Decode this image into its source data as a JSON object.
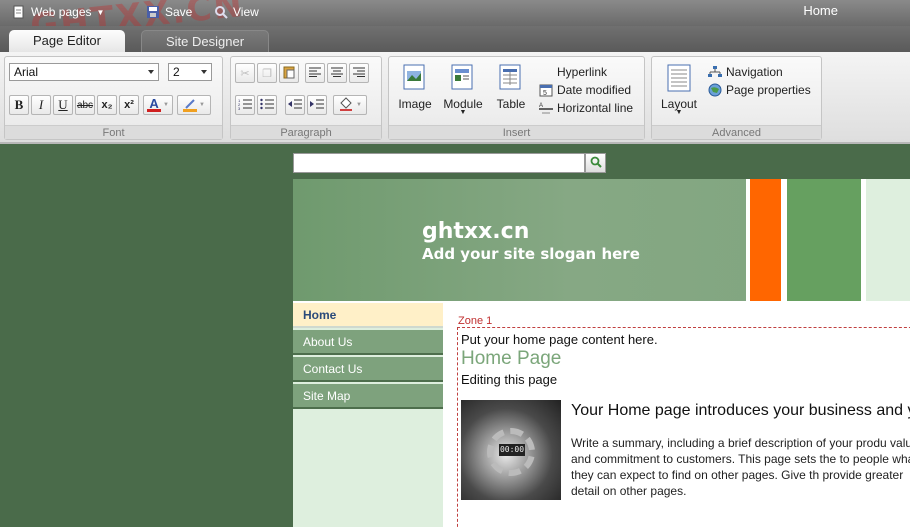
{
  "menubar": {
    "web_pages": "Web pages",
    "save": "Save",
    "view": "View",
    "home": "Home",
    "watermark": "GHTXX.CN"
  },
  "tabs": {
    "page_editor": "Page Editor",
    "site_designer": "Site Designer"
  },
  "ribbon": {
    "font": {
      "label": "Font",
      "family": "Arial",
      "size": "2",
      "bold": "B",
      "italic": "I",
      "underline": "U",
      "strike": "abc",
      "subscript": "x₂",
      "superscript": "x²",
      "font_color": "A",
      "font_color_hex": "#d02020",
      "highlight_hex": "#f0a020"
    },
    "paragraph": {
      "label": "Paragraph"
    },
    "insert": {
      "label": "Insert",
      "image": "Image",
      "module": "Module",
      "table": "Table",
      "hyperlink": "Hyperlink",
      "date_modified": "Date modified",
      "horizontal_line": "Horizontal line"
    },
    "advanced": {
      "label": "Advanced",
      "layout": "Layout",
      "navigation": "Navigation",
      "page_properties": "Page properties"
    }
  },
  "site": {
    "search_value": "",
    "title": "ghtxx.cn",
    "slogan": "Add your site slogan here",
    "nav": [
      {
        "label": "Home"
      },
      {
        "label": "About Us"
      },
      {
        "label": "Contact Us"
      },
      {
        "label": "Site Map"
      }
    ],
    "zone_label": "Zone 1",
    "placeholder": "Put your home page content here.",
    "heading": "Home Page",
    "subheading": "Editing this page",
    "thumb_clock": "00:00",
    "intro_title": "Your Home page introduces your business and yo",
    "intro_body": "Write a summary, including a brief description of your produ value and commitment to customers. This page sets the to people what they can expect to find on other pages. Give th provide greater detail on other pages."
  },
  "colors": {
    "canvas_bg": "#4a6b4a",
    "banner_orange": "#ff6600",
    "banner_green": "#66a060",
    "nav_bg": "#7ea27d",
    "nav_active": "#fff0c8",
    "heading_green": "#7ba67a"
  }
}
